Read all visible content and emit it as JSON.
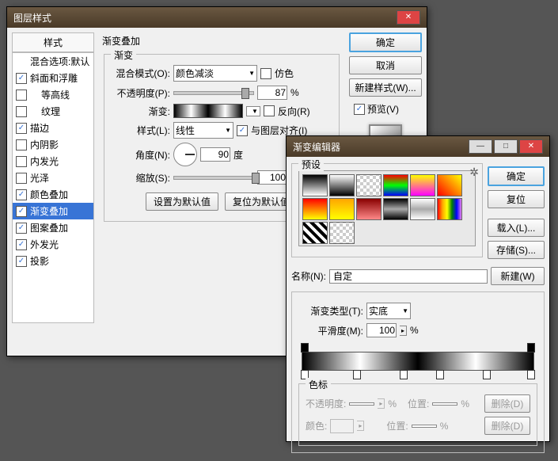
{
  "win1": {
    "title": "图层样式",
    "stylesHeader": "样式",
    "blendDefaults": "混合选项:默认",
    "items": [
      {
        "label": "斜面和浮雕",
        "checked": true
      },
      {
        "label": "等高线",
        "checked": false
      },
      {
        "label": "纹理",
        "checked": false
      },
      {
        "label": "描边",
        "checked": true
      },
      {
        "label": "内阴影",
        "checked": false
      },
      {
        "label": "内发光",
        "checked": false
      },
      {
        "label": "光泽",
        "checked": false
      },
      {
        "label": "颜色叠加",
        "checked": true
      },
      {
        "label": "渐变叠加",
        "checked": true,
        "sel": true
      },
      {
        "label": "图案叠加",
        "checked": true
      },
      {
        "label": "外发光",
        "checked": true
      },
      {
        "label": "投影",
        "checked": true
      }
    ],
    "sectionTitle": "渐变叠加",
    "gradGroupTitle": "渐变",
    "blendMode": {
      "label": "混合模式(O):",
      "value": "颜色减淡",
      "dither": "仿色"
    },
    "opacity": {
      "label": "不透明度(P):",
      "value": "87",
      "pct": "%"
    },
    "gradient": {
      "label": "渐变:",
      "reverse": "反向(R)"
    },
    "style": {
      "label": "样式(L):",
      "value": "线性",
      "align": "与图层对齐(I)"
    },
    "angle": {
      "label": "角度(N):",
      "value": "90",
      "unit": "度"
    },
    "scale": {
      "label": "缩放(S):",
      "value": "100",
      "pct": "%"
    },
    "setDefault": "设置为默认值",
    "resetDefault": "复位为默认值",
    "ok": "确定",
    "cancel": "取消",
    "newStyle": "新建样式(W)...",
    "preview": "预览(V)"
  },
  "win2": {
    "title": "渐变编辑器",
    "presets": "预设",
    "ok": "确定",
    "reset": "复位",
    "load": "载入(L)...",
    "save": "存储(S)...",
    "nameLabel": "名称(N):",
    "nameValue": "自定",
    "newBtn": "新建(W)",
    "gradType": {
      "label": "渐变类型(T):",
      "value": "实底"
    },
    "smooth": {
      "label": "平滑度(M):",
      "value": "100",
      "pct": "%"
    },
    "colorStops": "色标",
    "opacityLabel": "不透明度:",
    "pct": "%",
    "posLabel": "位置:",
    "delete": "删除(D)",
    "colorLabel": "颜色:"
  }
}
